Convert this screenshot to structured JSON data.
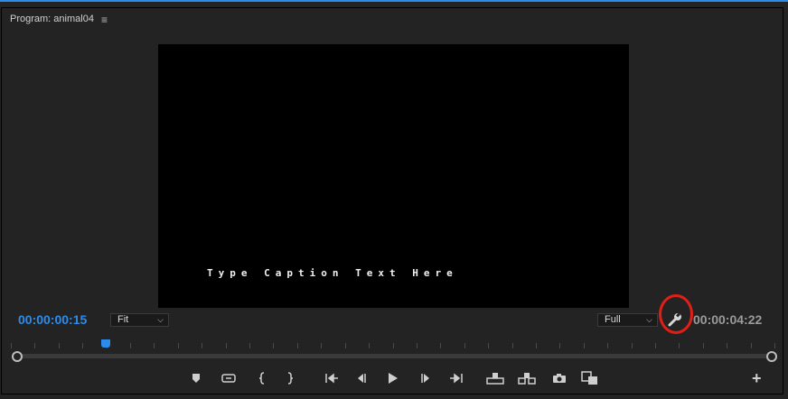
{
  "panel": {
    "title": "Program: animal04",
    "menu_icon": "hamburger-menu-icon"
  },
  "viewer": {
    "caption": "Type Caption Text Here"
  },
  "timecode": {
    "current": "00:00:00:15",
    "duration": "00:00:04:22"
  },
  "zoom_select": {
    "value": "Fit"
  },
  "resolution_select": {
    "value": "Full"
  },
  "settings": {
    "icon": "wrench-icon"
  },
  "playhead_position": 0.118,
  "controls": [
    {
      "name": "add-marker-button",
      "icon": "marker-icon"
    },
    {
      "name": "loop-button",
      "icon": "loop-icon"
    },
    {
      "name": "mark-in-button",
      "icon": "mark-in-icon"
    },
    {
      "name": "mark-out-button",
      "icon": "mark-out-icon"
    },
    {
      "name": "go-to-in-button",
      "icon": "go-to-in-icon"
    },
    {
      "name": "step-back-button",
      "icon": "step-back-icon"
    },
    {
      "name": "play-button",
      "icon": "play-icon"
    },
    {
      "name": "step-forward-button",
      "icon": "step-forward-icon"
    },
    {
      "name": "go-to-out-button",
      "icon": "go-to-out-icon"
    },
    {
      "name": "lift-button",
      "icon": "lift-icon"
    },
    {
      "name": "extract-button",
      "icon": "extract-icon"
    },
    {
      "name": "export-frame-button",
      "icon": "camera-icon"
    },
    {
      "name": "comparison-view-button",
      "icon": "comparison-view-icon"
    }
  ],
  "add_button": {
    "label": "+"
  },
  "colors": {
    "accent": "#2d8ceb",
    "highlight": "#e21f17",
    "panel_bg": "#232323"
  }
}
